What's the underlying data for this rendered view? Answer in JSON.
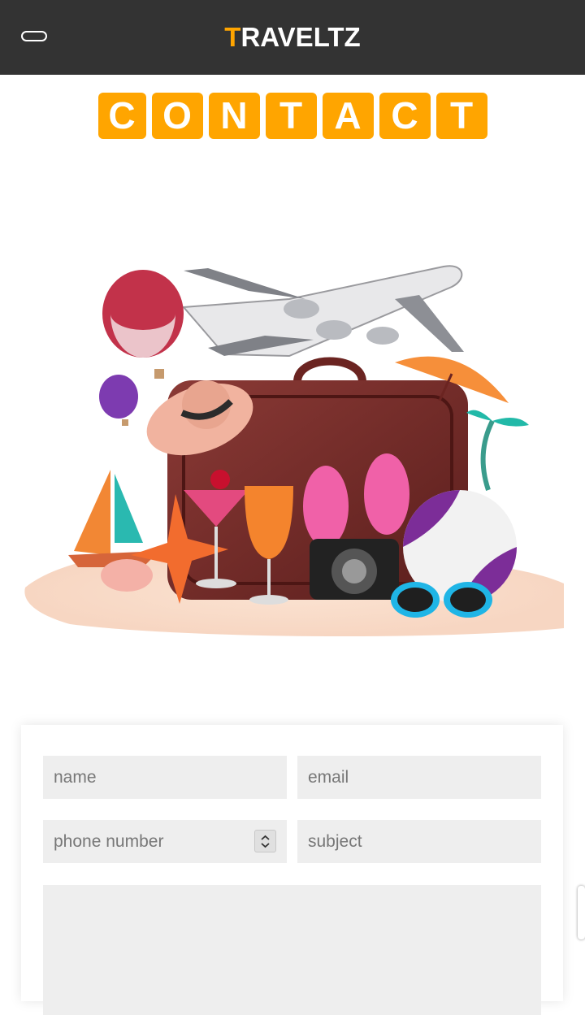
{
  "header": {
    "logo_first": "T",
    "logo_rest": "RAVELTZ",
    "menu_icon": "menu-toggle-icon"
  },
  "heading": {
    "letters": [
      "C",
      "O",
      "N",
      "T",
      "A",
      "C",
      "T"
    ]
  },
  "form": {
    "name_placeholder": "name",
    "email_placeholder": "email",
    "phone_placeholder": "phone number",
    "subject_placeholder": "subject",
    "message_placeholder": ""
  },
  "colors": {
    "accent": "#ffa500",
    "header_bg": "#333333",
    "field_bg": "#eeeeee"
  }
}
